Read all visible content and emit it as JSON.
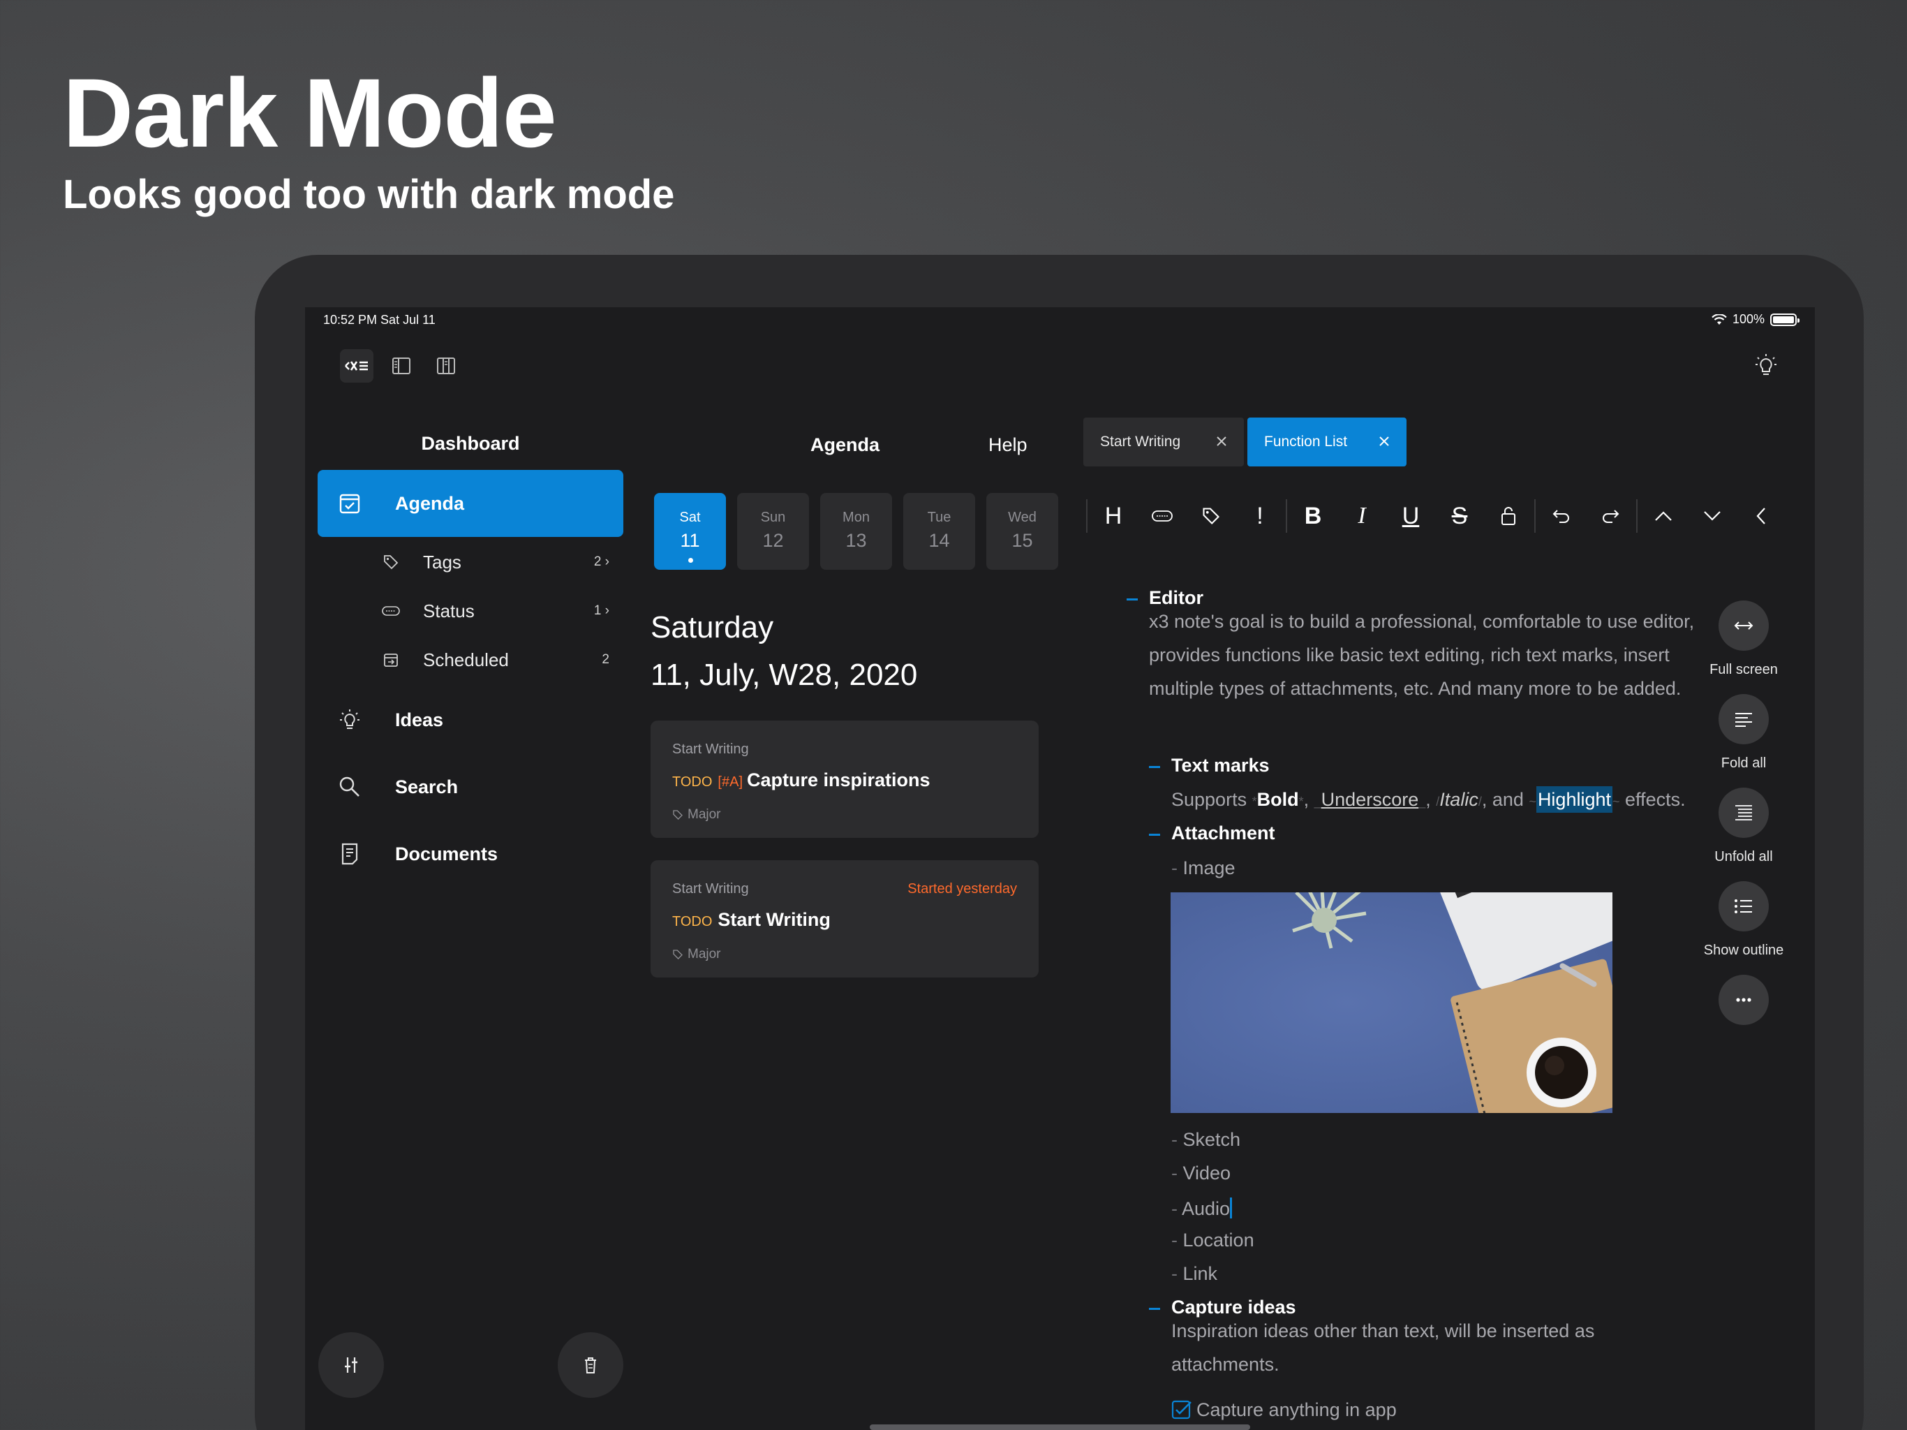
{
  "hero": {
    "title": "Dark Mode",
    "subtitle": "Looks good too with dark mode"
  },
  "status_bar": {
    "time": "10:52 PM   Sat Jul 11",
    "battery": "100%",
    "battery_level": 1.0
  },
  "top_icons": [
    "x3-logo-icon",
    "sidebar-layout-icon",
    "split-layout-icon",
    "lightbulb-icon"
  ],
  "sidebar": {
    "heading": "Dashboard",
    "agenda_label": "Agenda",
    "sub_items": [
      {
        "label": "Tags",
        "count": "2 ›",
        "icon": "tag-icon"
      },
      {
        "label": "Status",
        "count": "1 ›",
        "icon": "todo-status-icon"
      },
      {
        "label": "Scheduled",
        "count": "2",
        "icon": "scheduled-icon"
      }
    ],
    "items": [
      {
        "label": "Ideas",
        "icon": "lightbulb-icon"
      },
      {
        "label": "Search",
        "icon": "search-icon"
      },
      {
        "label": "Documents",
        "icon": "document-icon"
      }
    ]
  },
  "agenda": {
    "heading": "Agenda",
    "help": "Help",
    "days": [
      {
        "name": "Sat",
        "num": "11"
      },
      {
        "name": "Sun",
        "num": "12"
      },
      {
        "name": "Mon",
        "num": "13"
      },
      {
        "name": "Tue",
        "num": "14"
      },
      {
        "name": "Wed",
        "num": "15"
      }
    ],
    "day_title": "Saturday",
    "date_title": "11, July,  W28, 2020",
    "cards": [
      {
        "project": "Start Writing",
        "when": "",
        "todo": "TODO",
        "priority": "[#A]",
        "title": "Capture inspirations",
        "tag": "Major"
      },
      {
        "project": "Start Writing",
        "when": "Started yesterday",
        "todo": "TODO",
        "priority": "",
        "title": "Start Writing",
        "tag": "Major"
      }
    ]
  },
  "editor": {
    "tabs": [
      {
        "label": "Start Writing"
      },
      {
        "label": "Function List"
      }
    ],
    "toolbar": [
      "heading-icon",
      "todo-icon",
      "tag-icon",
      "priority-icon",
      "bold-icon",
      "italic-icon",
      "underline-icon",
      "strikethrough-icon",
      "lock-icon",
      "undo-icon",
      "redo-icon",
      "move-up-icon",
      "move-down-icon",
      "collapse-icon"
    ],
    "toolbar_labels": {
      "heading": "H",
      "priority": "!",
      "bold": "B",
      "italic": "I",
      "underline": "U",
      "strike": "S"
    },
    "h_editor": "Editor",
    "editor_body": "x3 note's goal is to build a professional, comfortable to use editor, provides functions like basic text editing, rich text marks, insert multiple types of attachments, etc. And many more to be added.",
    "h_text_marks": "Text marks",
    "tm_supports": "Supports",
    "tm_bold": "Bold",
    "tm_comma1": ",",
    "tm_underscore": "Underscore",
    "tm_comma2": ",",
    "tm_italic": "Italic",
    "tm_and": ", and",
    "tm_highlight": "Highlight",
    "tm_effects": "effects.",
    "h_attachment": "Attachment",
    "attachments": [
      "Image",
      "Sketch",
      "Video",
      "Audio",
      "Location",
      "Link"
    ],
    "h_capture": "Capture ideas",
    "capture_body": "Inspiration ideas other than text, will be inserted as attachments.",
    "checkbox_item": "Capture anything in app"
  },
  "side_actions": [
    {
      "label": "Full screen",
      "icon": "fullscreen-icon"
    },
    {
      "label": "Fold all",
      "icon": "fold-all-icon"
    },
    {
      "label": "Unfold all",
      "icon": "unfold-all-icon"
    },
    {
      "label": "Show outline",
      "icon": "outline-icon"
    },
    {
      "label": "",
      "icon": "more-icon"
    }
  ],
  "colors": {
    "accent": "#0a84d6",
    "background": "#1c1c1e",
    "card": "#2c2c2e",
    "todo": "#ffb54a",
    "alert": "#ff6a2c"
  }
}
